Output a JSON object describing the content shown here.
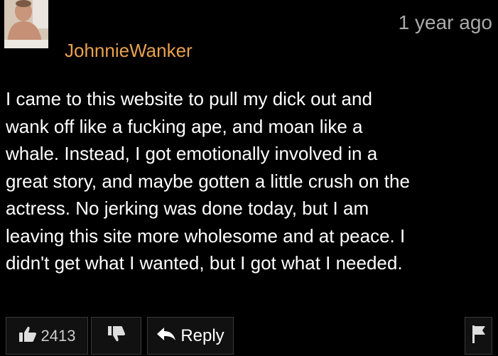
{
  "comment": {
    "avatar_icon": "user-photo",
    "username": "JohnnieWanker",
    "timestamp": "1 year ago",
    "lines": [
      "I came to this website to pull my dick out and",
      "wank off like a fucking ape, and moan like a",
      "whale. Instead, I got emotionally involved in a",
      "great story, and maybe gotten a little crush on the",
      "actress. No jerking was done today, but I am",
      "leaving this site more wholesome and at peace. I",
      "didn't get what I wanted, but I got what I needed."
    ]
  },
  "actions": {
    "like_icon": "thumbs-up-icon",
    "like_count": "2413",
    "dislike_icon": "thumbs-down-icon",
    "reply_icon": "reply-arrow-icon",
    "reply_label": "Reply",
    "flag_icon": "flag-icon"
  },
  "colors": {
    "background": "#000000",
    "username": "#e8a150",
    "text": "#ffffff",
    "muted": "#aaaaaa"
  }
}
